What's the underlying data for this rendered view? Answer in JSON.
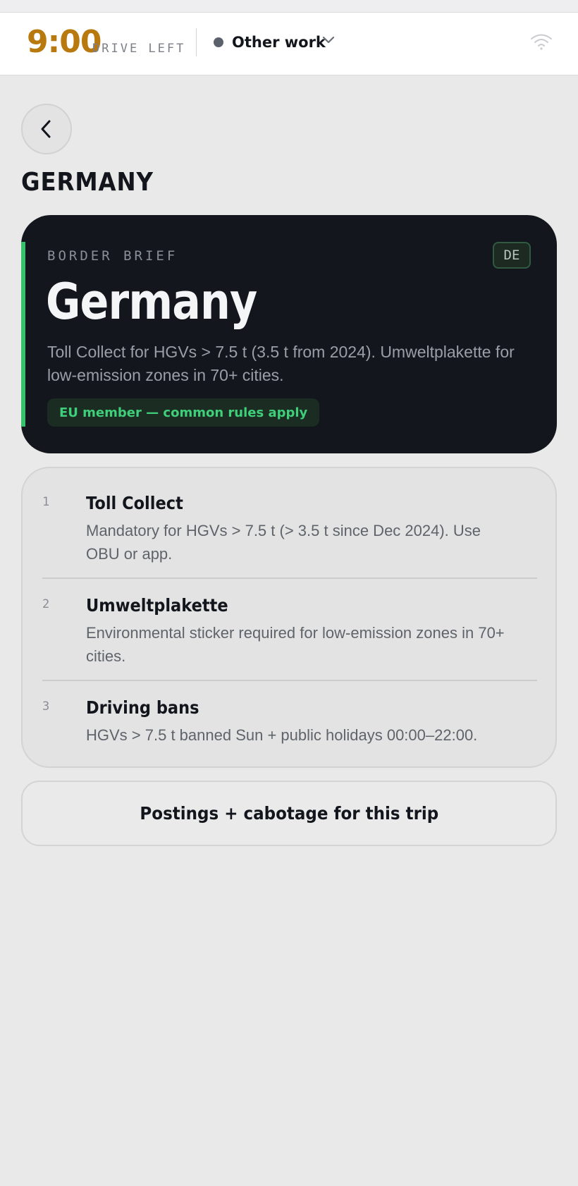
{
  "status_bar": {
    "drive_time": "9:00",
    "drive_label": "DRIVE LEFT",
    "activity": "Other work",
    "activity_dot_color": "#5b616b",
    "drive_time_color": "#b8790f",
    "icons": [
      "status-dot",
      "chevron-down-icon",
      "wifi-icon"
    ]
  },
  "page": {
    "back_icon": "chevron-left-icon",
    "title": "GERMANY"
  },
  "brief": {
    "eyebrow": "BORDER BRIEF",
    "country_code": "DE",
    "country": "Germany",
    "summary": "Toll Collect for HGVs > 7.5 t (3.5 t from 2024). Umweltplakette for low-emission zones in 70+ cities.",
    "badge": "EU member — common rules apply",
    "accent_color": "#35c26b"
  },
  "rules": [
    {
      "num": "1",
      "title": "Toll Collect",
      "desc": "Mandatory for HGVs > 7.5 t (> 3.5 t since Dec 2024). Use OBU or app."
    },
    {
      "num": "2",
      "title": "Umweltplakette",
      "desc": "Environmental sticker required for low-emission zones in 70+ cities."
    },
    {
      "num": "3",
      "title": "Driving bans",
      "desc": "HGVs > 7.5 t banned Sun + public holidays 00:00–22:00."
    }
  ],
  "cta": {
    "label": "Postings + cabotage for this trip"
  }
}
